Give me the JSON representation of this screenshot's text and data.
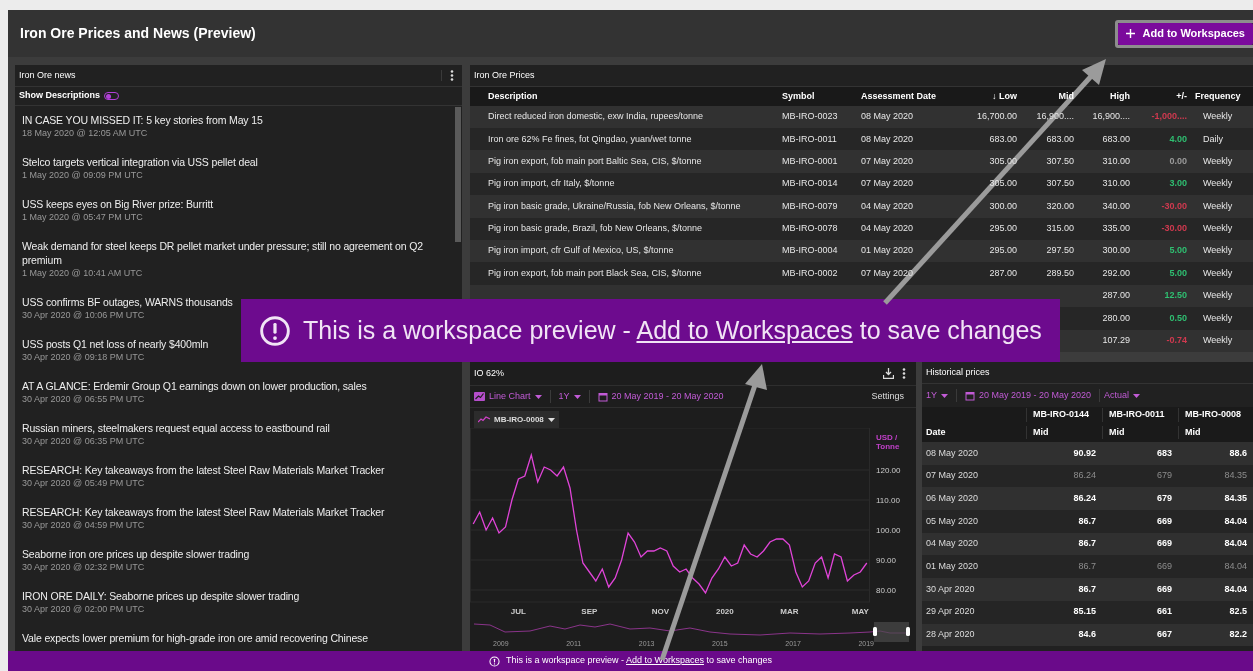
{
  "header": {
    "title": "Iron Ore Prices and News (Preview)",
    "button": "Add to Workspaces"
  },
  "news": {
    "title": "Iron Ore news",
    "toggle": {
      "label": "Show Descriptions",
      "on": false
    },
    "items": [
      {
        "title": "IN CASE YOU MISSED IT: 5 key stories from May 15",
        "time": "18 May 2020 @ 12:05 AM UTC"
      },
      {
        "title": "Stelco targets vertical integration via USS pellet deal",
        "time": "1 May 2020 @ 09:09 PM UTC"
      },
      {
        "title": "USS keeps eyes on Big River prize: Burritt",
        "time": "1 May 2020 @ 05:47 PM UTC"
      },
      {
        "title": "Weak demand for steel keeps DR pellet market under pressure; still no agreement on Q2 premium",
        "time": "1 May 2020 @ 10:41 AM UTC"
      },
      {
        "title": "USS confirms BF outages, WARNS thousands",
        "time": "30 Apr 2020 @ 10:06 PM UTC"
      },
      {
        "title": "USS posts Q1 net loss of nearly $400mln",
        "time": "30 Apr 2020 @ 09:18 PM UTC"
      },
      {
        "title": "AT A GLANCE: Erdemir Group Q1 earnings down on lower production, sales",
        "time": "30 Apr 2020 @ 06:55 PM UTC"
      },
      {
        "title": "Russian miners, steelmakers request equal access to eastbound rail",
        "time": "30 Apr 2020 @ 06:35 PM UTC"
      },
      {
        "title": "RESEARCH: Key takeaways from the latest Steel Raw Materials Market Tracker",
        "time": "30 Apr 2020 @ 05:49 PM UTC"
      },
      {
        "title": "RESEARCH: Key takeaways from the latest Steel Raw Materials Market Tracker",
        "time": "30 Apr 2020 @ 04:59 PM UTC"
      },
      {
        "title": "Seaborne iron ore prices up despite slower trading",
        "time": "30 Apr 2020 @ 02:32 PM UTC"
      },
      {
        "title": "IRON ORE DAILY: Seaborne prices up despite slower trading",
        "time": "30 Apr 2020 @ 02:00 PM UTC"
      },
      {
        "title": "Vale expects lower premium for high-grade iron ore amid recovering Chinese"
      }
    ]
  },
  "prices": {
    "title": "Iron Ore Prices",
    "columns": [
      "Description",
      "Symbol",
      "Assessment Date",
      "↓ Low",
      "Mid",
      "High",
      "+/-",
      "Frequency"
    ],
    "rows": [
      {
        "description": "Direct reduced iron domestic, exw India, rupees/tonne",
        "symbol": "MB-IRO-0023",
        "date": "08 May 2020",
        "low": "16,700.00",
        "mid": "16,900....",
        "high": "16,900....",
        "change": "-1,000....",
        "color": "#d0394f",
        "frequency": "Weekly"
      },
      {
        "description": "Iron ore 62% Fe fines, fot Qingdao, yuan/wet tonne",
        "symbol": "MB-IRO-0011",
        "date": "08 May 2020",
        "low": "683.00",
        "mid": "683.00",
        "high": "683.00",
        "change": "4.00",
        "color": "#2fbf71",
        "frequency": "Daily"
      },
      {
        "description": "Pig iron export, fob main port Baltic Sea, CIS, $/tonne",
        "symbol": "MB-IRO-0001",
        "date": "07 May 2020",
        "low": "305.00",
        "mid": "307.50",
        "high": "310.00",
        "change": "0.00",
        "color": "#9a9a9a",
        "frequency": "Weekly"
      },
      {
        "description": "Pig iron import, cfr Italy, $/tonne",
        "symbol": "MB-IRO-0014",
        "date": "07 May 2020",
        "low": "305.00",
        "mid": "307.50",
        "high": "310.00",
        "change": "3.00",
        "color": "#2fbf71",
        "frequency": "Weekly"
      },
      {
        "description": "Pig iron basic grade, Ukraine/Russia, fob New Orleans, $/tonne",
        "symbol": "MB-IRO-0079",
        "date": "04 May 2020",
        "low": "300.00",
        "mid": "320.00",
        "high": "340.00",
        "change": "-30.00",
        "color": "#d0394f",
        "frequency": "Weekly"
      },
      {
        "description": "Pig iron basic grade, Brazil, fob New Orleans, $/tonne",
        "symbol": "MB-IRO-0078",
        "date": "04 May 2020",
        "low": "295.00",
        "mid": "315.00",
        "high": "335.00",
        "change": "-30.00",
        "color": "#d0394f",
        "frequency": "Weekly"
      },
      {
        "description": "Pig iron import, cfr Gulf of Mexico, US, $/tonne",
        "symbol": "MB-IRO-0004",
        "date": "01 May 2020",
        "low": "295.00",
        "mid": "297.50",
        "high": "300.00",
        "change": "5.00",
        "color": "#2fbf71",
        "frequency": "Weekly"
      },
      {
        "description": "Pig iron export, fob main port Black Sea, CIS, $/tonne",
        "symbol": "MB-IRO-0002",
        "date": "07 May 2020",
        "low": "287.00",
        "mid": "289.50",
        "high": "292.00",
        "change": "5.00",
        "color": "#2fbf71",
        "frequency": "Weekly"
      },
      {
        "high": "287.00",
        "change": "12.50",
        "color": "#2fbf71",
        "frequency": "Weekly"
      },
      {
        "high": "280.00",
        "change": "0.50",
        "color": "#2fbf71",
        "frequency": "Weekly"
      },
      {
        "high": "107.29",
        "change": "-0.74",
        "color": "#d0394f",
        "frequency": "Weekly"
      }
    ]
  },
  "chart_panel": {
    "title": "IO 62%",
    "chart_type": "Line Chart",
    "period": "1Y",
    "range": "20 May 2019 - 20 May 2020",
    "settings": "Settings",
    "chart_data": {
      "type": "line",
      "ylabel": "USD / Tonne",
      "grid": true,
      "ylim": [
        76,
        134
      ],
      "categories": [
        null,
        null,
        null,
        null,
        null,
        null,
        null,
        "JUL",
        null,
        null,
        null,
        null,
        null,
        null,
        null,
        null,
        null,
        null,
        "SEP",
        null,
        null,
        null,
        null,
        null,
        null,
        null,
        null,
        null,
        null,
        "NOV",
        null,
        null,
        null,
        null,
        null,
        null,
        null,
        null,
        null,
        "2020",
        null,
        null,
        null,
        null,
        null,
        null,
        null,
        null,
        null,
        "MAR",
        null,
        null,
        null,
        null,
        null,
        null,
        null,
        null,
        null,
        null,
        "MAY",
        null
      ],
      "yticks": [
        {
          "value": 80,
          "label": "80.00"
        },
        {
          "value": 90,
          "label": "90.00"
        },
        {
          "value": 100,
          "label": "100.00"
        },
        {
          "value": 110,
          "label": "110.00"
        },
        {
          "value": 120,
          "label": "120.00"
        }
      ],
      "series": [
        {
          "name": "MB-IRO-0008",
          "color": "#e044d8",
          "values": [
            102,
            106,
            100,
            104,
            99,
            101,
            110,
            117,
            118,
            125,
            116,
            121,
            120,
            118,
            121,
            114,
            100,
            89,
            86,
            83,
            87,
            81,
            84,
            90,
            99,
            96,
            91,
            93,
            93,
            94,
            93,
            88,
            86,
            87,
            84,
            82,
            79,
            84,
            87,
            91,
            88,
            89,
            95,
            92,
            91,
            93,
            96,
            97,
            97,
            95,
            86,
            81,
            83,
            89,
            91,
            84,
            92,
            91,
            83,
            85,
            86,
            89
          ]
        }
      ]
    },
    "navigator_labels": [
      "2009",
      "2011",
      "2013",
      "2015",
      "2017",
      "2019"
    ]
  },
  "history": {
    "title": "Historical prices",
    "period": "1Y",
    "range": "20 May 2019 - 20 May 2020",
    "mode": "Actual",
    "date_header": "Date",
    "columns": [
      {
        "code": "MB-IRO-0144",
        "field": "Mid"
      },
      {
        "code": "MB-IRO-0011",
        "field": "Mid"
      },
      {
        "code": "MB-IRO-0008",
        "field": "Mid"
      }
    ],
    "rows": [
      {
        "date": "08 May 2020",
        "values": [
          "90.92",
          "683",
          "88.6"
        ],
        "dimmed": false
      },
      {
        "date": "07 May 2020",
        "values": [
          "86.24",
          "679",
          "84.35"
        ],
        "dimmed": true
      },
      {
        "date": "06 May 2020",
        "values": [
          "86.24",
          "679",
          "84.35"
        ],
        "dimmed": false
      },
      {
        "date": "05 May 2020",
        "values": [
          "86.7",
          "669",
          "84.04"
        ],
        "dimmed": false
      },
      {
        "date": "04 May 2020",
        "values": [
          "86.7",
          "669",
          "84.04"
        ],
        "dimmed": false
      },
      {
        "date": "01 May 2020",
        "values": [
          "86.7",
          "669",
          "84.04"
        ],
        "dimmed": true
      },
      {
        "date": "30 Apr 2020",
        "values": [
          "86.7",
          "669",
          "84.04"
        ],
        "dimmed": false
      },
      {
        "date": "29 Apr 2020",
        "values": [
          "85.15",
          "661",
          "82.5"
        ],
        "dimmed": false
      },
      {
        "date": "28 Apr 2020",
        "values": [
          "84.6",
          "667",
          "82.2"
        ],
        "dimmed": false
      }
    ]
  },
  "callout": {
    "before": "This is a workspace preview - ",
    "link": "Add to Workspaces",
    "after": " to save changes"
  },
  "banner": {
    "before": "This is a workspace preview - ",
    "link": "Add to Workspaces",
    "after": " to save changes"
  }
}
